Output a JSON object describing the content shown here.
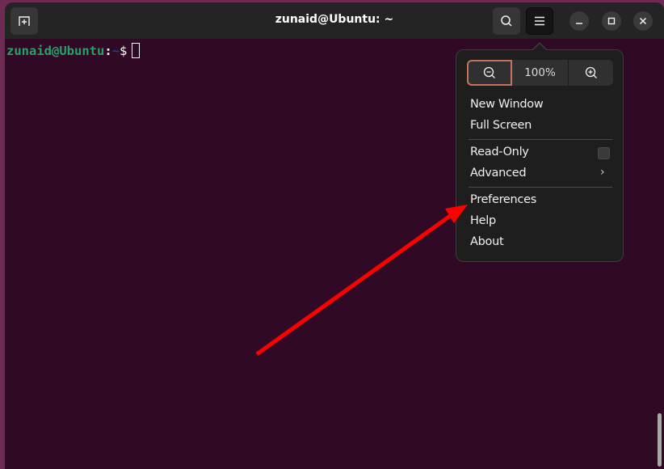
{
  "window": {
    "title": "zunaid@Ubuntu: ~",
    "new_tab_icon": "new-tab-icon",
    "search_icon": "search-icon",
    "menu_icon": "hamburger-menu-icon",
    "minimize_icon": "minimize-icon",
    "maximize_icon": "maximize-icon",
    "close_icon": "close-icon"
  },
  "terminal": {
    "prompt_user_host": "zunaid@Ubuntu",
    "prompt_colon": ":",
    "prompt_path": "~",
    "prompt_symbol": "$"
  },
  "menu": {
    "zoom_out_icon": "zoom-out-icon",
    "zoom_level": "100%",
    "zoom_in_icon": "zoom-in-icon",
    "items": [
      {
        "label": "New Window"
      },
      {
        "label": "Full Screen"
      },
      {
        "label": "Read-Only",
        "checked": false
      },
      {
        "label": "Advanced",
        "submenu": true
      },
      {
        "label": "Preferences"
      },
      {
        "label": "Help"
      },
      {
        "label": "About"
      }
    ]
  },
  "annotation": {
    "type": "arrow",
    "color": "#ff0000",
    "points_to": "Preferences"
  },
  "colors": {
    "terminal_bg": "#300a24",
    "headerbar_bg": "#242424",
    "popover_bg": "#1e1e1e",
    "accent": "#c7735a",
    "prompt_user": "#26a269",
    "prompt_path": "#12488b"
  }
}
